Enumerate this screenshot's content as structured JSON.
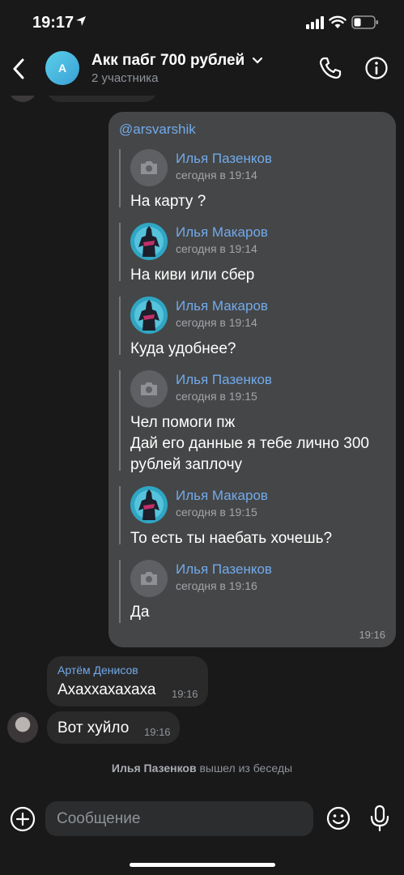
{
  "status_bar": {
    "time": "19:17"
  },
  "header": {
    "avatar_letter": "A",
    "title": "Акк пабг 700 рублей",
    "subtitle": "2 участника"
  },
  "forwarded": {
    "mention": "@arsvarshik",
    "time": "19:16",
    "quotes": [
      {
        "name": "Илья Пазенков",
        "date": "сегодня в 19:14",
        "text": "На карту ?",
        "avatar": "camera-icon"
      },
      {
        "name": "Илья Макаров",
        "date": "сегодня в 19:14",
        "text": "На киви или сбер",
        "avatar": "character-avatar"
      },
      {
        "name": "Илья Макаров",
        "date": "сегодня в 19:14",
        "text": "Куда удобнее?",
        "avatar": "character-avatar"
      },
      {
        "name": "Илья Пазенков",
        "date": "сегодня в 19:15",
        "text": "Чел  помоги пж\nДай его данные я тебе лично 300 рублей заплочу",
        "avatar": "camera-icon"
      },
      {
        "name": "Илья Макаров",
        "date": "сегодня в 19:15",
        "text": "То есть ты наебать хочешь?",
        "avatar": "character-avatar"
      },
      {
        "name": "Илья Пазенков",
        "date": "сегодня в 19:16",
        "text": "Да",
        "avatar": "camera-icon"
      }
    ]
  },
  "messages": [
    {
      "sender": "Артём Денисов",
      "text": "Ахаххахахаха",
      "time": "19:16"
    },
    {
      "sender": "",
      "text": "Вот хуйло",
      "time": "19:16"
    }
  ],
  "system": {
    "name": "Илья Пазенков",
    "action": "вышел из беседы"
  },
  "composer": {
    "placeholder": "Сообщение"
  },
  "colors": {
    "accent": "#71aaeb",
    "background": "#19191a",
    "bubble_out": "#454647",
    "bubble_in": "#2a2a2b"
  }
}
